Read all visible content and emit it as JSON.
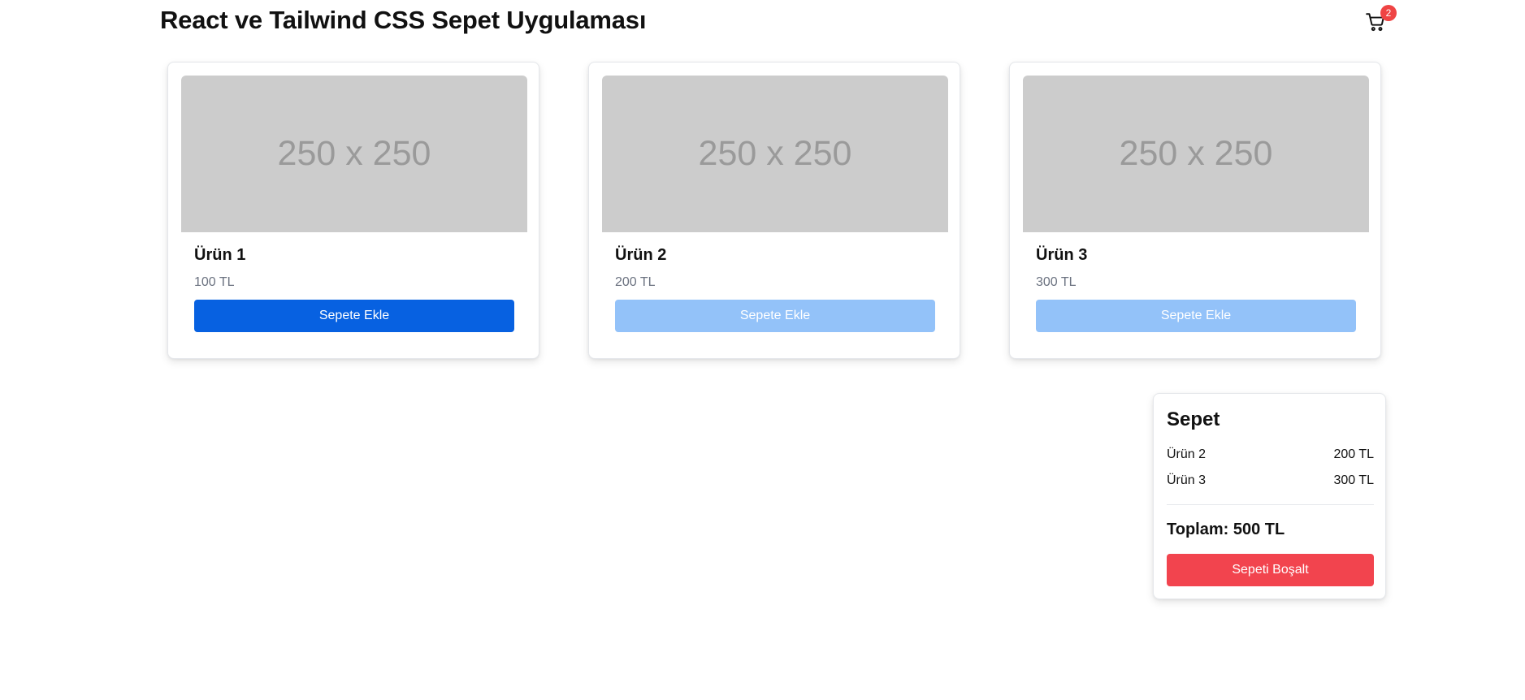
{
  "header": {
    "title": "React ve Tailwind CSS Sepet Uygulaması",
    "cart_icon": "shopping-cart-icon",
    "cart_count": "2"
  },
  "products": [
    {
      "image_text": "250 x 250",
      "name": "Ürün 1",
      "price": "100 TL",
      "button_label": "Sepete Ekle",
      "button_state": "enabled"
    },
    {
      "image_text": "250 x 250",
      "name": "Ürün 2",
      "price": "200 TL",
      "button_label": "Sepete Ekle",
      "button_state": "disabled"
    },
    {
      "image_text": "250 x 250",
      "name": "Ürün 3",
      "price": "300 TL",
      "button_label": "Sepete Ekle",
      "button_state": "disabled"
    }
  ],
  "cart": {
    "title": "Sepet",
    "items": [
      {
        "name": "Ürün 2",
        "price": "200 TL"
      },
      {
        "name": "Ürün 3",
        "price": "300 TL"
      }
    ],
    "total_label": "Toplam:",
    "total_value": "500 TL",
    "clear_label": "Sepeti Boşalt"
  },
  "colors": {
    "primary": "#0761e1",
    "primary_disabled": "#93c2f9",
    "danger": "#f2444e",
    "badge": "#ef4444",
    "placeholder_bg": "#cccccc",
    "placeholder_text": "#9a9a9a"
  }
}
